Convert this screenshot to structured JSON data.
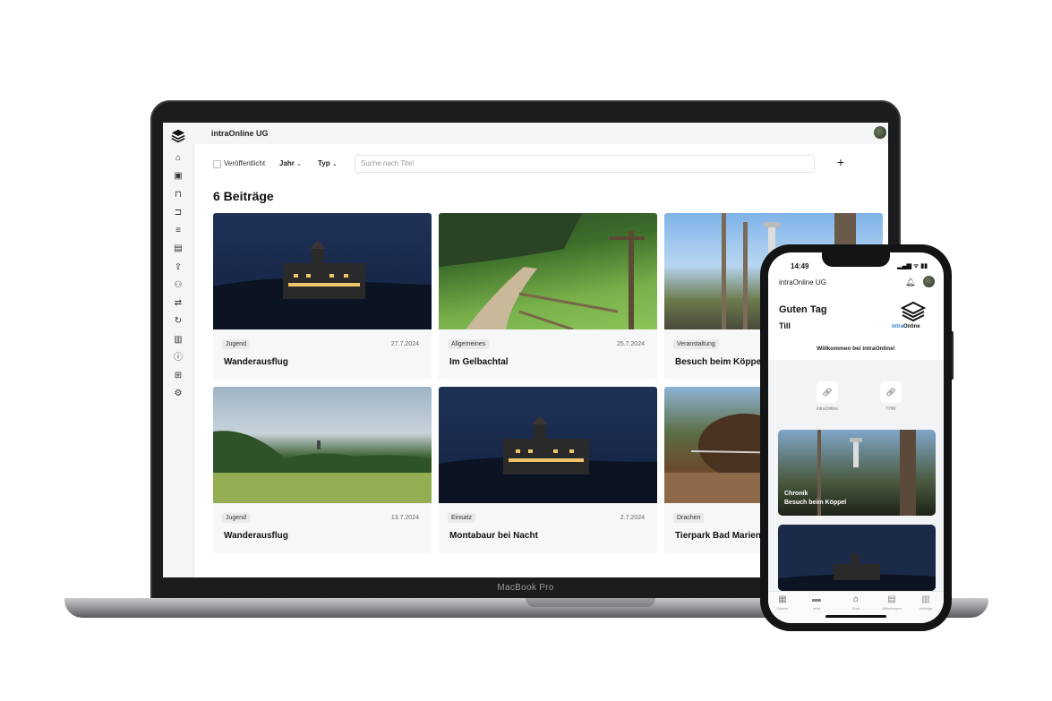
{
  "laptop": {
    "device_label": "MacBook Pro",
    "app": {
      "org_name": "intraOnline UG",
      "sidebar_icons": [
        "home-icon",
        "image-icon",
        "book-icon",
        "folder-icon",
        "list-icon",
        "table-icon",
        "upload-icon",
        "users-icon",
        "sort-icon",
        "refresh-icon",
        "document-icon",
        "info-icon",
        "book-open-icon",
        "settings-icon"
      ],
      "filters": {
        "published_label": "Veröffentlicht",
        "year_label": "Jahr",
        "type_label": "Typ",
        "search_placeholder": "Suche nach Titel",
        "add_label": "+"
      },
      "page_title": "6 Beiträge",
      "cards": [
        {
          "tag": "Jugend",
          "date": "27.7.2024",
          "title": "Wanderausflug"
        },
        {
          "tag": "Allgemeines",
          "date": "25.7.2024",
          "title": "Im Gelbachtal"
        },
        {
          "tag": "Veranstaltung",
          "date": "",
          "title": "Besuch beim Köppel"
        },
        {
          "tag": "Jugend",
          "date": "13.7.2024",
          "title": "Wanderausflug"
        },
        {
          "tag": "Einsatz",
          "date": "2.7.2024",
          "title": "Montabaur bei Nacht"
        },
        {
          "tag": "Drachen",
          "date": "",
          "title": "Tierpark Bad Marien"
        }
      ]
    }
  },
  "phone": {
    "time": "14:49",
    "status_icons": "▂▄▆ ᯤ ▮▮",
    "org_name": "intraOnline UG",
    "greeting": "Guten Tag",
    "user_name": "Till",
    "logo_text_a": "intra",
    "logo_text_b": "Online",
    "welcome": "Willkommen bei intraOnline!",
    "links": [
      {
        "label": "intraOnline"
      },
      {
        "label": "THW"
      }
    ],
    "featured": {
      "category": "Chronik",
      "title": "Besuch beim Köppel"
    },
    "tabs": [
      "Galerie",
      "Infos",
      "Start",
      "Mitteilungen",
      "Aufträge"
    ]
  }
}
